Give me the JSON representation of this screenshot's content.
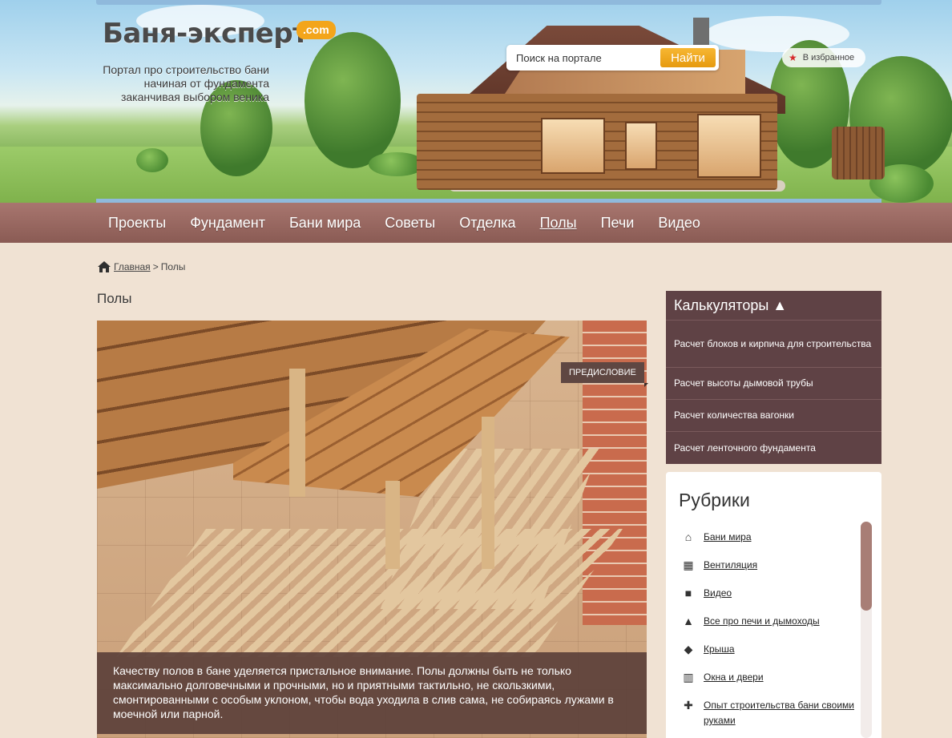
{
  "header": {
    "logo_name": "Баня-эксперт",
    "logo_com": ".com",
    "tagline": [
      "Портал про строительство бани",
      "начиная от фундамента",
      "заканчивая выбором веника"
    ],
    "search": {
      "placeholder": "Поиск на портале",
      "button": "Найти"
    },
    "favorites": "В избранное"
  },
  "nav": {
    "items": [
      "Проекты",
      "Фундамент",
      "Бани мира",
      "Советы",
      "Отделка",
      "Полы",
      "Печи",
      "Видео"
    ],
    "active": "Полы"
  },
  "breadcrumb": {
    "home": "Главная",
    "separator": ">",
    "current": "Полы"
  },
  "page": {
    "title": "Полы",
    "badge": "ПРЕДИСЛОВИЕ",
    "caption": "Качеству полов в бане уделяется пристальное внимание. Полы должны быть не только максимально долговечными и прочными, но и приятными тактильно, не скользкими, смонтированными с особым уклоном, чтобы вода уходила в слив сама, не собираясь лужами в моечной или парной."
  },
  "calculators": {
    "title": "Калькуляторы ▲",
    "items": [
      "Расчет блоков и кирпича для строительства",
      "Расчет высоты дымовой трубы",
      "Расчет количества вагонки",
      "Расчет ленточного фундамента"
    ]
  },
  "rubrics": {
    "title": "Рубрики",
    "items": [
      {
        "label": "Бани мира",
        "icon": "house-icon"
      },
      {
        "label": "Вентиляция",
        "icon": "fan-icon"
      },
      {
        "label": "Видео",
        "icon": "video-camera-icon"
      },
      {
        "label": "Все про печи и дымоходы",
        "icon": "flame-icon"
      },
      {
        "label": "Крыша",
        "icon": "roof-icon"
      },
      {
        "label": "Окна и двери",
        "icon": "window-door-icon"
      },
      {
        "label": "Опыт строительства бани своими руками",
        "icon": "tools-icon"
      }
    ]
  },
  "colors": {
    "nav_bg": "#96645d",
    "sidebar_bg": "#5f4245",
    "accent": "#f3a51b",
    "page_bg": "#f0e2d3"
  }
}
